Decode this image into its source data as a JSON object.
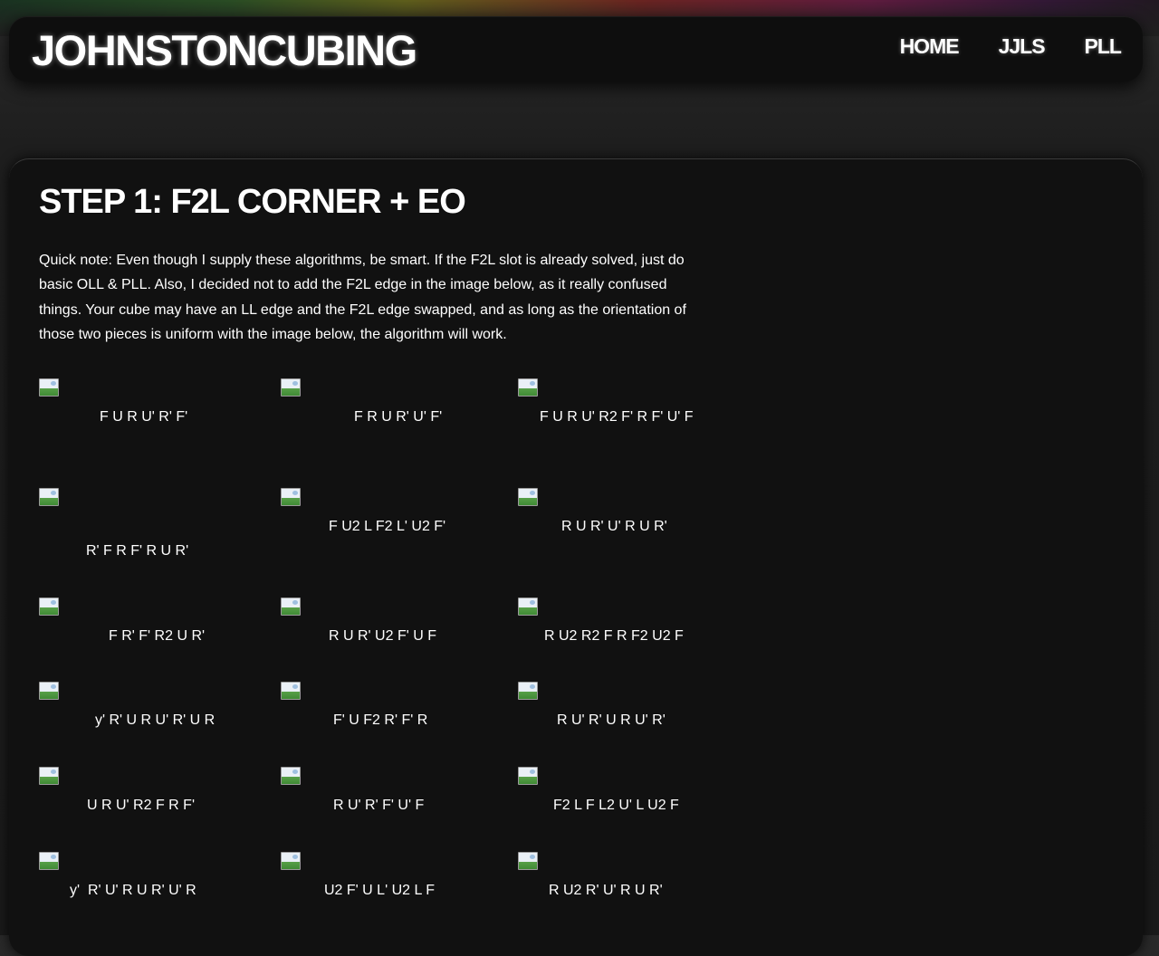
{
  "site": {
    "logo": "JOHNSTONCUBING",
    "nav": [
      "HOME",
      "JJLS",
      "PLL"
    ]
  },
  "page": {
    "title": "STEP 1: F2L CORNER + EO",
    "intro_lines": [
      "Quick note: Even though I supply these algorithms, be smart. If the F2L slot is already solved, just do",
      "basic OLL & PLL. Also, I decided not to add the F2L edge in the image below, as it really confused",
      "things. Your cube may have an LL edge and the F2L edge swapped, and as long as the orientation of",
      "those two pieces is uniform with the image below, the algorithm will work."
    ]
  },
  "algorithms": [
    "F U R U' R' F'",
    "F R U R' U' F'",
    "F U R U' R2 F' R F' U' F",
    "R' F R F' R U R'",
    "F U2 L F2 L' U2 F'",
    "R U R' U' R U R'",
    "F R' F' R2 U R'",
    "R U R' U2 F' U F",
    "R U2 R2 F R F2 U2 F",
    "y' R' U R U' R' U R",
    "F' U F2 R' F' R",
    "R U' R' U R U' R'",
    "U R U' R2 F R F'",
    "R U' R' F' U' F",
    "F2 L F L2 U' L U2 F",
    "y'  R' U' R U R' U' R",
    "U2 F' U L' U2 L F",
    "R U2 R' U' R U R'"
  ]
}
